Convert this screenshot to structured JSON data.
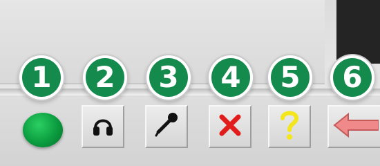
{
  "callouts": [
    "1",
    "2",
    "3",
    "4",
    "5",
    "6"
  ],
  "toolbar": {
    "items": [
      {
        "name": "status-indicator",
        "icon": "green-dot-icon",
        "color": "#0b9c3f"
      },
      {
        "name": "headphones-button",
        "icon": "headphones-icon",
        "color": "#111111"
      },
      {
        "name": "microphone-button",
        "icon": "microphone-icon",
        "color": "#111111"
      },
      {
        "name": "cancel-button",
        "icon": "red-x-icon",
        "color": "#e11c1c"
      },
      {
        "name": "help-button",
        "icon": "question-mark-icon",
        "color": "#f4e61d"
      },
      {
        "name": "back-button",
        "icon": "left-arrow-icon",
        "color": "#f08a8a"
      }
    ]
  },
  "colors": {
    "badge": "#148a4d",
    "dark_panel": "#242424"
  }
}
